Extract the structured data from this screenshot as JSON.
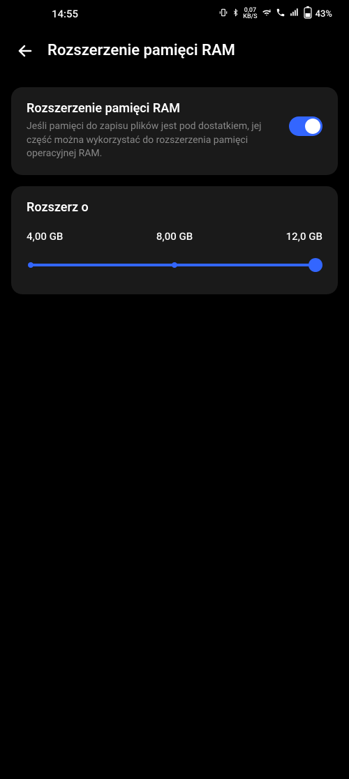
{
  "statusBar": {
    "time": "14:55",
    "speed": "0,07",
    "speedUnit": "KB/S",
    "battery": "43%"
  },
  "header": {
    "title": "Rozszerzenie pamięci RAM"
  },
  "mainCard": {
    "title": "Rozszerzenie pamięci RAM",
    "description": "Jeśli pamięci do zapisu plików jest pod dostatkiem, jej część można wykorzystać do rozszerzenia pamięci operacyjnej RAM."
  },
  "sliderCard": {
    "title": "Rozszerz o",
    "options": [
      "4,00 GB",
      "8,00 GB",
      "12,0 GB"
    ]
  }
}
